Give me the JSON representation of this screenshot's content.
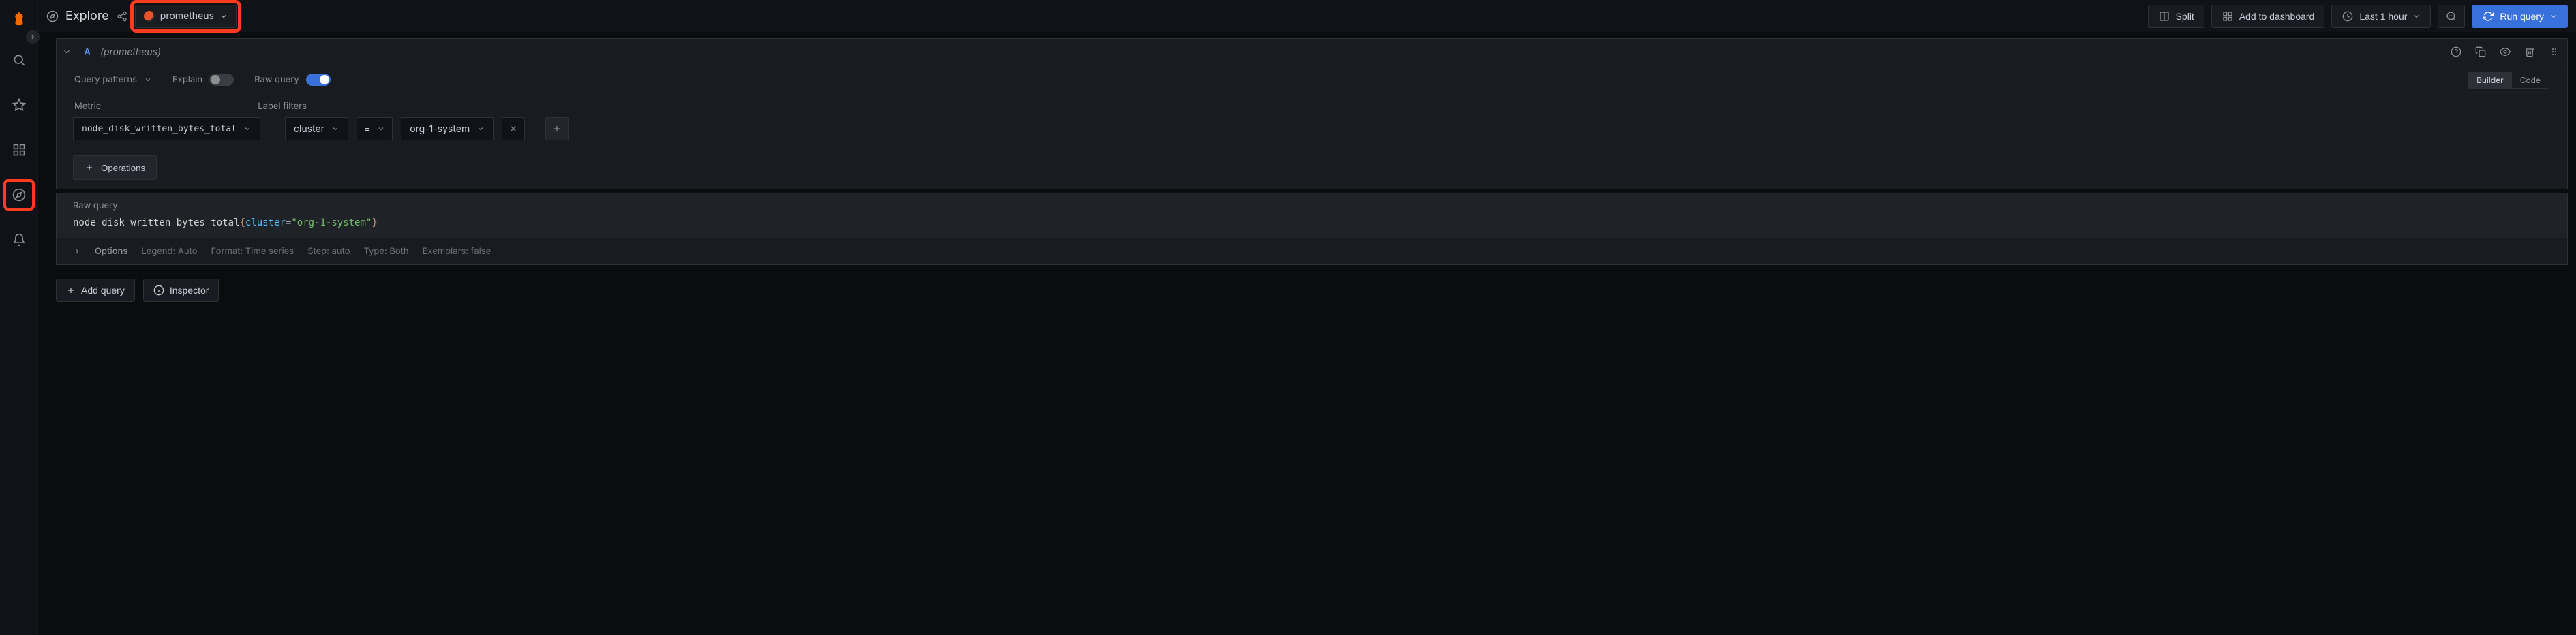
{
  "page": {
    "title": "Explore"
  },
  "datasource": {
    "name": "prometheus"
  },
  "toolbar": {
    "split": "Split",
    "add_dashboard": "Add to dashboard",
    "time_range": "Last 1 hour",
    "run_query": "Run query"
  },
  "query": {
    "letter": "A",
    "ds_hint": "(prometheus)",
    "patterns_label": "Query patterns",
    "explain_label": "Explain",
    "explain_on": false,
    "rawquery_label": "Raw query",
    "rawquery_on": true,
    "mode": {
      "builder": "Builder",
      "code": "Code",
      "active": "builder"
    },
    "metric_label": "Metric",
    "metric_value": "node_disk_written_bytes_total",
    "filters_label": "Label filters",
    "filter": {
      "key": "cluster",
      "op": "=",
      "value": "org-1-system"
    },
    "operations_btn": "Operations",
    "raw_label": "Raw query",
    "raw_tokens": {
      "metric": "node_disk_written_bytes_total",
      "open": "{",
      "key": "cluster",
      "eq": "=",
      "q1": "\"",
      "val": "org-1-system",
      "q2": "\"",
      "close": "}"
    },
    "options": {
      "label": "Options",
      "legend": "Legend: Auto",
      "format": "Format: Time series",
      "step": "Step: auto",
      "type": "Type: Both",
      "exemplars": "Exemplars: false"
    }
  },
  "bottom": {
    "add_query": "Add query",
    "inspector": "Inspector"
  },
  "icons": {
    "search": "search-icon",
    "star": "star-icon",
    "apps": "apps-icon",
    "compass": "compass-icon",
    "bell": "bell-icon"
  }
}
